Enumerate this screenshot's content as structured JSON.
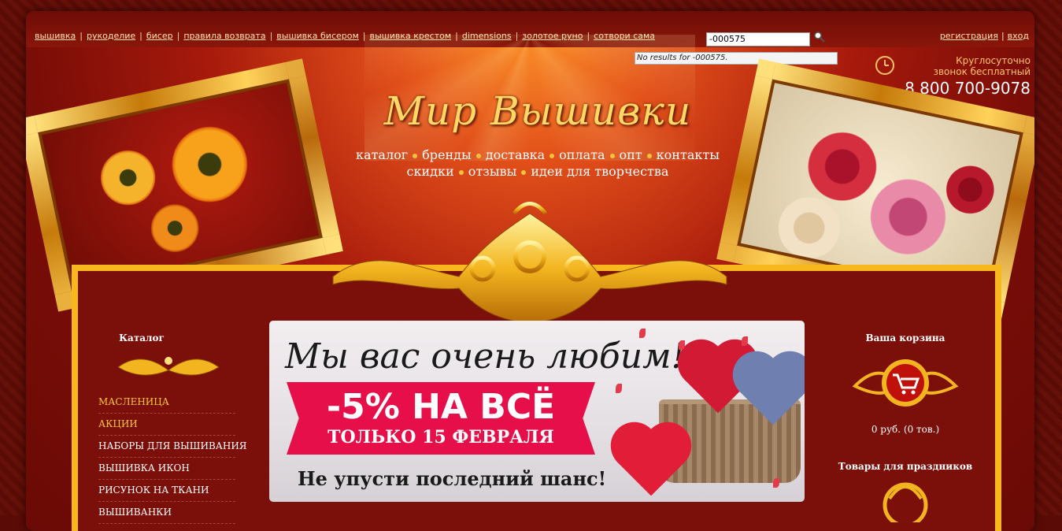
{
  "top_links": [
    "вышивка",
    "рукоделие",
    "бисер",
    "правила возврата",
    "вышивка бисером",
    "вышивка крестом",
    "dimensions",
    "золотое руно",
    "сотвори сама"
  ],
  "search": {
    "value": "-000575",
    "result": "No results for -000575."
  },
  "auth": {
    "register": "регистрация",
    "login": "вход"
  },
  "phone": {
    "note_line1": "Круглосуточно",
    "note_line2": "звонок бесплатный",
    "number": "8 800 700-9078"
  },
  "logo": "Мир Вышивки",
  "main_nav": {
    "row1": [
      "каталог",
      "бренды",
      "доставка",
      "оплата",
      "опт",
      "контакты"
    ],
    "row2": [
      "скидки",
      "отзывы",
      "идеи для творчества"
    ]
  },
  "catalog": {
    "title": "Каталог",
    "items": [
      "МАСЛЕНИЦА",
      "АКЦИИ",
      "НАБОРЫ ДЛЯ ВЫШИВАНИЯ",
      "ВЫШИВКА ИКОН",
      "РИСУНОК НА ТКАНИ",
      "ВЫШИВАНКИ"
    ],
    "highlighted_count": 2
  },
  "banner": {
    "heading": "Мы вас очень любим!",
    "sale": "-5% НА ВСЁ",
    "date": "ТОЛЬКО 15 ФЕВРАЛЯ",
    "tagline": "Не упусти последний шанс!"
  },
  "cart": {
    "title": "Ваша корзина",
    "total": "0 руб.   (0 тов.)"
  },
  "holiday": {
    "title": "Товары для праздников"
  },
  "colors": {
    "gold": "#f7b71d",
    "accent_red": "#e60f49",
    "background": "#7b0f0a"
  }
}
